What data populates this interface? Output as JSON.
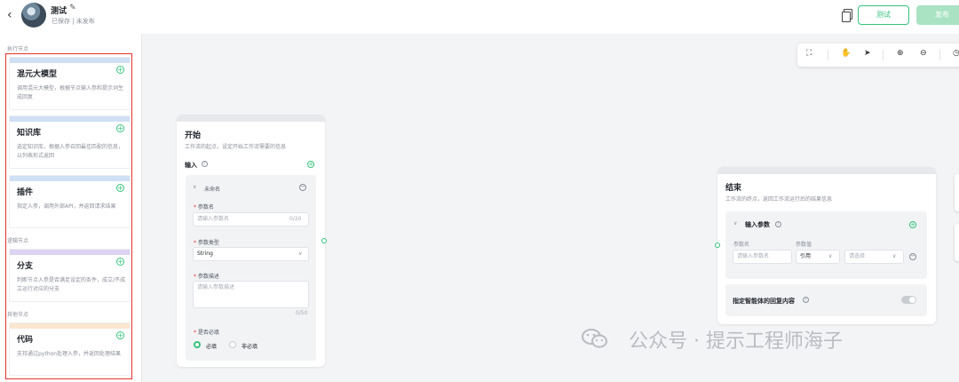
{
  "header": {
    "back_icon": "chevron-left-icon",
    "title": "测试",
    "status": "已保存 | 未发布",
    "test_label": "测试",
    "publish_label": "发布"
  },
  "sidebar": {
    "sections": [
      "执行节点",
      "逻辑节点",
      "其他节点"
    ],
    "cards": [
      {
        "title": "混元大模型",
        "desc": "调用混元大模型，根据节点输入参和提示词生成回复",
        "color": "#cfe0f5"
      },
      {
        "title": "知识库",
        "desc": "选定知识库，根据入参召回最佳匹配的信息，以列表形式返回",
        "color": "#cfe0f5"
      },
      {
        "title": "插件",
        "desc": "指定入参，调用外部API，并返回请求结果",
        "color": "#cfe0f5"
      },
      {
        "title": "分支",
        "desc": "判断节点入参是否满足设定的条件，成立/不成立运行对应的分支",
        "color": "#ddd3f2"
      },
      {
        "title": "代码",
        "desc": "支持通过python处理入参，并返回处理结果",
        "color": "#fbe6cf"
      }
    ]
  },
  "toolbar": {
    "icons": [
      "fit-screen-icon",
      "hand-icon",
      "pointer-icon",
      "zoom-in-icon",
      "zoom-out-icon"
    ]
  },
  "start_node": {
    "title": "开始",
    "desc": "工作流的起点，设定开始工作流需要的信息",
    "input_label": "输入",
    "param_name_label": "未命名",
    "field_name_label": "参数名",
    "field_name_placeholder": "请输入参数名",
    "field_name_counter": "0/20",
    "field_type_label": "参数类型",
    "field_type_value": "String",
    "field_desc_label": "参数描述",
    "field_desc_placeholder": "请输入参数描述",
    "field_desc_counter": "0/50",
    "required_label": "是否必填",
    "required_yes": "必填",
    "required_no": "非必填"
  },
  "end_node": {
    "title": "结束",
    "desc": "工作流的终点，返回工作流运行后的结果信息",
    "output_label": "输入参数",
    "col_name": "参数名",
    "col_value": "参数值",
    "name_placeholder": "请输入参数名",
    "ref_value": "引用",
    "select_placeholder": "请选择",
    "reply_label": "指定智能体的回复内容"
  },
  "watermark": "公众号 · 提示工程师海子",
  "colors": {
    "accent": "#36c37c",
    "highlight": "#e5332b"
  }
}
